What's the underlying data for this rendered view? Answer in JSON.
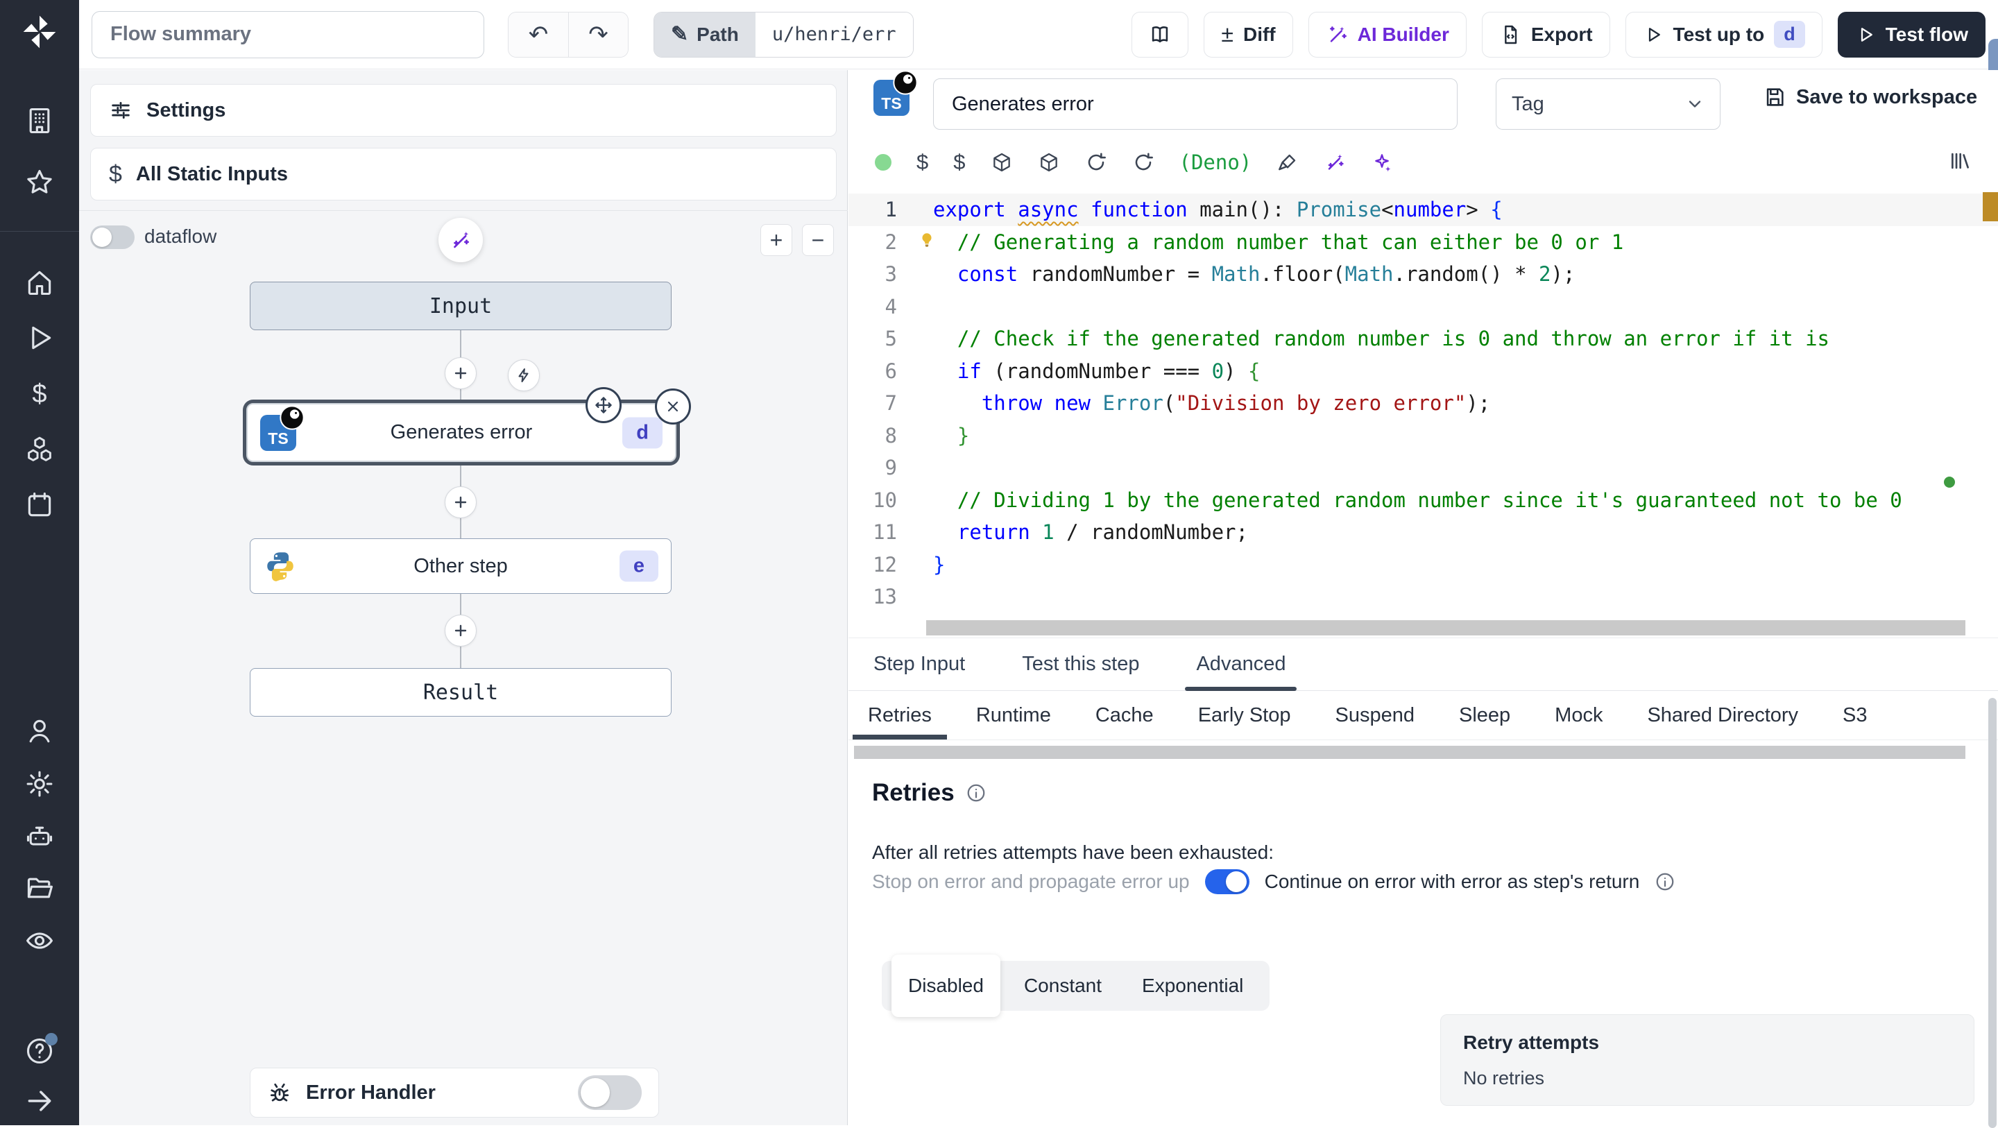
{
  "topbar": {
    "flow_summary_placeholder": "Flow summary",
    "path_label": "Path",
    "path_value": "u/henri/err",
    "diff_label": "Diff",
    "ai_builder_label": "AI Builder",
    "export_label": "Export",
    "test_up_to_label": "Test up to",
    "test_up_to_key": "d",
    "test_flow_label": "Test flow"
  },
  "sidebar": {
    "icons": [
      "windmill-logo",
      "building",
      "star",
      "home",
      "play",
      "dollar",
      "cubes",
      "calendar",
      "user",
      "settings",
      "robot",
      "folder",
      "eye",
      "help",
      "arrow-right"
    ]
  },
  "flow": {
    "settings_label": "Settings",
    "static_inputs_label": "All Static Inputs",
    "dataflow_label": "dataflow",
    "zoom_in": "+",
    "zoom_out": "−",
    "nodes": {
      "input_label": "Input",
      "step1_title": "Generates error",
      "step1_badge": "d",
      "step2_title": "Other step",
      "step2_badge": "e",
      "result_label": "Result"
    },
    "error_handler_label": "Error Handler"
  },
  "inspector": {
    "step_title": "Generates error",
    "tag_placeholder": "Tag",
    "save_label": "Save to workspace",
    "runtime_label": "(Deno)",
    "tabs": [
      {
        "label": "Step Input"
      },
      {
        "label": "Test this step"
      },
      {
        "label": "Advanced"
      }
    ],
    "subtabs": [
      {
        "label": "Retries"
      },
      {
        "label": "Runtime"
      },
      {
        "label": "Cache"
      },
      {
        "label": "Early Stop"
      },
      {
        "label": "Suspend"
      },
      {
        "label": "Sleep"
      },
      {
        "label": "Mock"
      },
      {
        "label": "Shared Directory"
      },
      {
        "label": "S3"
      }
    ],
    "retries": {
      "heading": "Retries",
      "exhausted_text": "After all retries attempts have been exhausted:",
      "stop_label": "Stop on error and propagate error up",
      "continue_label": "Continue on error with error as step's return",
      "modes": [
        "Disabled",
        "Constant",
        "Exponential"
      ],
      "active_mode": "Disabled",
      "retry_attempts_label": "Retry attempts",
      "retry_attempts_value": "No retries"
    }
  },
  "editor": {
    "language": "typescript",
    "lines": [
      [
        [
          "k",
          "export"
        ],
        [
          "p",
          " "
        ],
        [
          "k sq",
          "async"
        ],
        [
          "p",
          " "
        ],
        [
          "k",
          "function"
        ],
        [
          "p",
          " main(): "
        ],
        [
          "t",
          "Promise"
        ],
        [
          "p",
          "<"
        ],
        [
          "k",
          "number"
        ],
        [
          "p",
          "> "
        ],
        [
          "bb",
          "{"
        ]
      ],
      [
        [
          "p",
          "  "
        ],
        [
          "c",
          "// Generating a random number that can either be 0 or 1"
        ]
      ],
      [
        [
          "p",
          "  "
        ],
        [
          "k",
          "const"
        ],
        [
          "p",
          " randomNumber = "
        ],
        [
          "t",
          "Math"
        ],
        [
          "p",
          ".floor("
        ],
        [
          "t",
          "Math"
        ],
        [
          "p",
          ".random() * "
        ],
        [
          "n",
          "2"
        ],
        [
          "p",
          ");"
        ]
      ],
      [],
      [
        [
          "p",
          "  "
        ],
        [
          "c",
          "// Check if the generated random number is 0 and throw an error if it is"
        ]
      ],
      [
        [
          "p",
          "  "
        ],
        [
          "k",
          "if"
        ],
        [
          "p",
          " (randomNumber === "
        ],
        [
          "n",
          "0"
        ],
        [
          "p",
          ") "
        ],
        [
          "bg",
          "{"
        ]
      ],
      [
        [
          "p",
          "    "
        ],
        [
          "k",
          "throw"
        ],
        [
          "p",
          " "
        ],
        [
          "k",
          "new"
        ],
        [
          "p",
          " "
        ],
        [
          "t",
          "Error"
        ],
        [
          "p",
          "("
        ],
        [
          "s",
          "\"Division by zero error\""
        ],
        [
          "p",
          ");"
        ]
      ],
      [
        [
          "p",
          "  "
        ],
        [
          "bg",
          "}"
        ]
      ],
      [],
      [
        [
          "p",
          "  "
        ],
        [
          "c",
          "// Dividing 1 by the generated random number since it's guaranteed not to be 0"
        ]
      ],
      [
        [
          "p",
          "  "
        ],
        [
          "k",
          "return"
        ],
        [
          "p",
          " "
        ],
        [
          "n",
          "1"
        ],
        [
          "p",
          " / randomNumber;"
        ]
      ],
      [
        [
          "bb",
          "}"
        ]
      ],
      []
    ]
  },
  "colors": {
    "accent_blue": "#2563eb",
    "brand_purple": "#6d28d9",
    "ts_blue": "#3178c6",
    "deno_green": "#1a9c3f",
    "badge_bg": "#dfe3fb",
    "badge_text": "#4040c0",
    "sidebar_bg": "#262b36"
  }
}
